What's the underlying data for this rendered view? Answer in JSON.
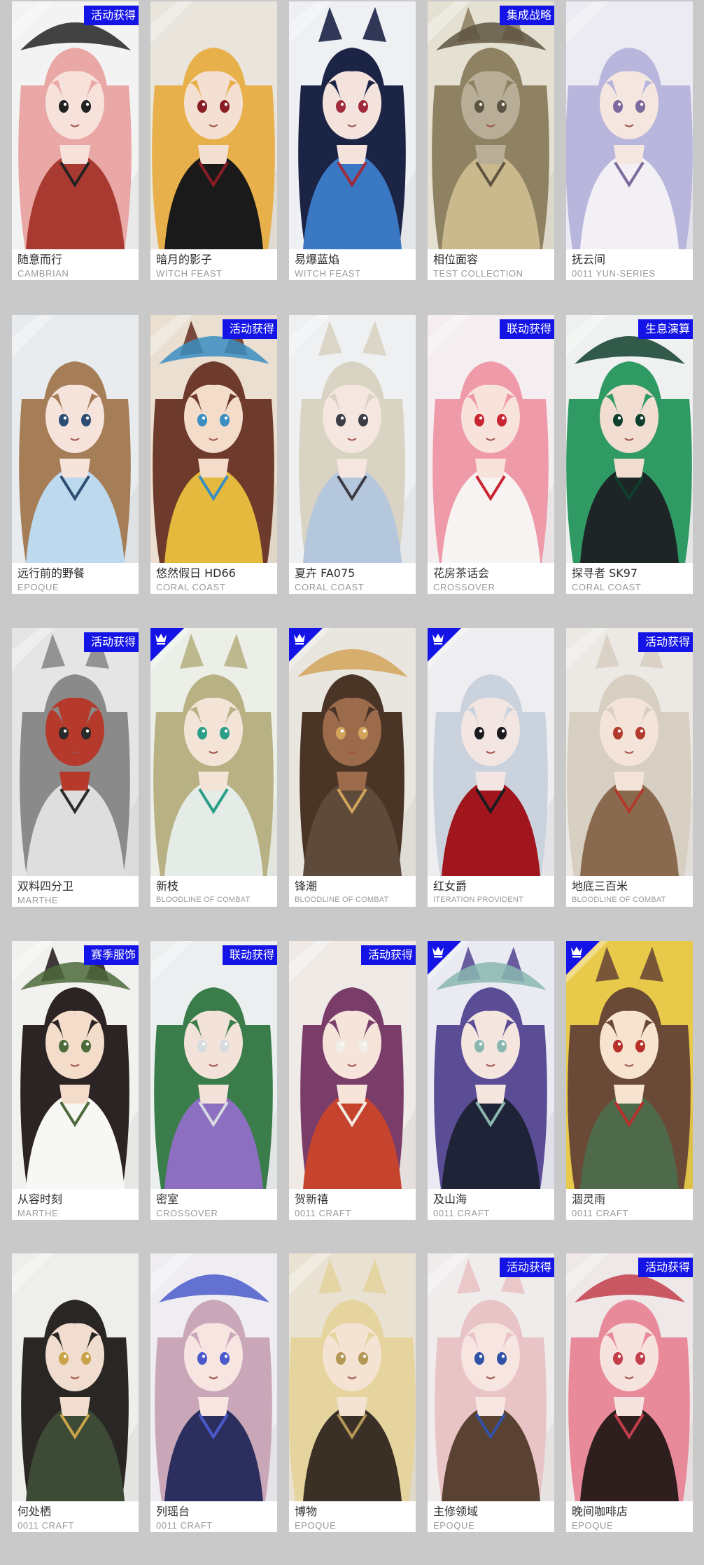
{
  "colors": {
    "page_background": "#c9c9c9",
    "tag_background": "#1414e6",
    "tag_text": "#ffffff",
    "name_text": "#2d2d2d",
    "series_text": "#9a9a9a"
  },
  "rows": [
    {
      "cards": [
        {
          "name": "随意而行",
          "series": "CAMBRIAN",
          "tag": "活动获得",
          "badge": "",
          "palette": {
            "bg": "#f3f3f3",
            "hair": "#e9a8a6",
            "cloth": "#a93a31",
            "skin": "#f6e2da",
            "accent": "#222222"
          }
        },
        {
          "name": "暗月的影子",
          "series": "WITCH FEAST",
          "tag": "",
          "badge": "",
          "palette": {
            "bg": "#e9e4dc",
            "hair": "#e7b04a",
            "cloth": "#1a1a1a",
            "skin": "#f4e0d2",
            "accent": "#8a1c24"
          }
        },
        {
          "name": "易爆蓝焰",
          "series": "WITCH FEAST",
          "tag": "",
          "badge": "",
          "palette": {
            "bg": "#eef0f4",
            "hair": "#1c2446",
            "cloth": "#3a78c4",
            "skin": "#f4e3dc",
            "accent": "#a12b3a"
          }
        },
        {
          "name": "相位面容",
          "series": "TEST COLLECTION",
          "tag": "集成战略",
          "badge": "",
          "palette": {
            "bg": "#e4e0d2",
            "hair": "#8f8263",
            "cloth": "#c9b98c",
            "skin": "#b8ad96",
            "accent": "#5e5441"
          }
        },
        {
          "name": "抚云间",
          "series": "0011 YUN-SERIES",
          "tag": "",
          "badge": "",
          "palette": {
            "bg": "#eceaf2",
            "hair": "#b9b6dd",
            "cloth": "#f2f0f4",
            "skin": "#f5e6e0",
            "accent": "#7d6a9e"
          }
        }
      ]
    },
    {
      "cards": [
        {
          "name": "远行前的野餐",
          "series": "EPOQUE",
          "tag": "",
          "badge": "",
          "palette": {
            "bg": "#e8ecef",
            "hair": "#a57d57",
            "cloth": "#bcd9ee",
            "skin": "#f6e4dc",
            "accent": "#2d4e72"
          }
        },
        {
          "name": "悠然假日 HD66",
          "series": "CORAL COAST",
          "tag": "活动获得",
          "badge": "",
          "palette": {
            "bg": "#eadfd0",
            "hair": "#6d3a2b",
            "cloth": "#e4b93e",
            "skin": "#f4dccb",
            "accent": "#3a8ec2"
          }
        },
        {
          "name": "夏卉 FA075",
          "series": "CORAL COAST",
          "tag": "",
          "badge": "",
          "palette": {
            "bg": "#eef0f2",
            "hair": "#d8d3c2",
            "cloth": "#b4c7dd",
            "skin": "#f5e6df",
            "accent": "#3c3c46"
          }
        },
        {
          "name": "花房茶话会",
          "series": "CROSSOVER",
          "tag": "联动获得",
          "badge": "",
          "palette": {
            "bg": "#f4eef0",
            "hair": "#ef9aa8",
            "cloth": "#f7f3f2",
            "skin": "#f8e2dc",
            "accent": "#c92431"
          }
        },
        {
          "name": "探寻者 SK97",
          "series": "CORAL COAST",
          "tag": "生息演算",
          "badge": "",
          "palette": {
            "bg": "#eef1ef",
            "hair": "#2f9a64",
            "cloth": "#1d2526",
            "skin": "#f2ddd2",
            "accent": "#0f3f2d"
          }
        }
      ]
    },
    {
      "cards": [
        {
          "name": "双料四分卫",
          "series": "MARTHE",
          "tag": "活动获得",
          "badge": "",
          "palette": {
            "bg": "#e5e5e6",
            "hair": "#8a8a8a",
            "cloth": "#dedede",
            "skin": "#b53a2c",
            "accent": "#2a2a2a"
          }
        },
        {
          "name": "新枝",
          "series": "BLOODLINE OF COMBAT",
          "tag": "",
          "badge": "crown",
          "palette": {
            "bg": "#ecefe8",
            "hair": "#b8b184",
            "cloth": "#e5ebe6",
            "skin": "#f4e4d8",
            "accent": "#2b9e88"
          }
        },
        {
          "name": "锋潮",
          "series": "BLOODLINE OF COMBAT",
          "tag": "",
          "badge": "crown",
          "palette": {
            "bg": "#e9e5df",
            "hair": "#4a3426",
            "cloth": "#5d4a3a",
            "skin": "#9c6b4c",
            "accent": "#d2a45a"
          }
        },
        {
          "name": "红女爵",
          "series": "ITERATION PROVIDENT",
          "tag": "",
          "badge": "crown",
          "palette": {
            "bg": "#eeeef1",
            "hair": "#cad2de",
            "cloth": "#a1151d",
            "skin": "#f3e6e2",
            "accent": "#1a1a1f"
          }
        },
        {
          "name": "地底三百米",
          "series": "BLOODLINE OF COMBAT",
          "tag": "活动获得",
          "badge": "",
          "palette": {
            "bg": "#ece9e4",
            "hair": "#d8cfc3",
            "cloth": "#8a6a4e",
            "skin": "#f4e3d8",
            "accent": "#b23a2d"
          }
        }
      ]
    },
    {
      "cards": [
        {
          "name": "从容时刻",
          "series": "MARTHE",
          "tag": "赛季服饰",
          "badge": "",
          "palette": {
            "bg": "#f1f1ef",
            "hair": "#2c2324",
            "cloth": "#f7f7f5",
            "skin": "#f3dcc9",
            "accent": "#4d6a3a"
          }
        },
        {
          "name": "密室",
          "series": "CROSSOVER",
          "tag": "联动获得",
          "badge": "",
          "palette": {
            "bg": "#eceff0",
            "hair": "#3a7d4a",
            "cloth": "#8c6fc0",
            "skin": "#f3e2da",
            "accent": "#d7dbe0"
          }
        },
        {
          "name": "贺新禧",
          "series": "0011 CRAFT",
          "tag": "活动获得",
          "badge": "",
          "palette": {
            "bg": "#efeae6",
            "hair": "#7a3d6a",
            "cloth": "#c6442d",
            "skin": "#f6e3d9",
            "accent": "#f1ede7"
          }
        },
        {
          "name": "及山海",
          "series": "0011 CRAFT",
          "tag": "",
          "badge": "crown",
          "palette": {
            "bg": "#e9eaf2",
            "hair": "#5b4c96",
            "cloth": "#1f2338",
            "skin": "#f4e5df",
            "accent": "#8ab7b0"
          }
        },
        {
          "name": "涸灵雨",
          "series": "0011 CRAFT",
          "tag": "",
          "badge": "crown",
          "palette": {
            "bg": "#e8c94a",
            "hair": "#6a4a36",
            "cloth": "#4e6a4a",
            "skin": "#f6e3d0",
            "accent": "#b8302a"
          }
        }
      ]
    },
    {
      "cards": [
        {
          "name": "何处栖",
          "series": "0011 CRAFT",
          "tag": "",
          "badge": "",
          "palette": {
            "bg": "#eeeeec",
            "hair": "#2a2623",
            "cloth": "#3c4a36",
            "skin": "#f1ddd0",
            "accent": "#c9a34a"
          }
        },
        {
          "name": "列瑶台",
          "series": "0011 CRAFT",
          "tag": "",
          "badge": "",
          "palette": {
            "bg": "#efedf1",
            "hair": "#c9a7b8",
            "cloth": "#2c2f5e",
            "skin": "#f6e5e0",
            "accent": "#4a5acb"
          }
        },
        {
          "name": "博物",
          "series": "EPOQUE",
          "tag": "",
          "badge": "",
          "palette": {
            "bg": "#e9e2d3",
            "hair": "#e5d49e",
            "cloth": "#3b3026",
            "skin": "#f4e3d2",
            "accent": "#b39754"
          }
        },
        {
          "name": "主修领域",
          "series": "EPOQUE",
          "tag": "活动获得",
          "badge": "",
          "palette": {
            "bg": "#efeceb",
            "hair": "#e9c4c7",
            "cloth": "#5a4232",
            "skin": "#f6e5e1",
            "accent": "#3152a6"
          }
        },
        {
          "name": "晚间咖啡店",
          "series": "EPOQUE",
          "tag": "活动获得",
          "badge": "",
          "palette": {
            "bg": "#efe8e8",
            "hair": "#e98a9a",
            "cloth": "#2e1e1e",
            "skin": "#f6e3df",
            "accent": "#c23e4a"
          }
        }
      ]
    }
  ]
}
